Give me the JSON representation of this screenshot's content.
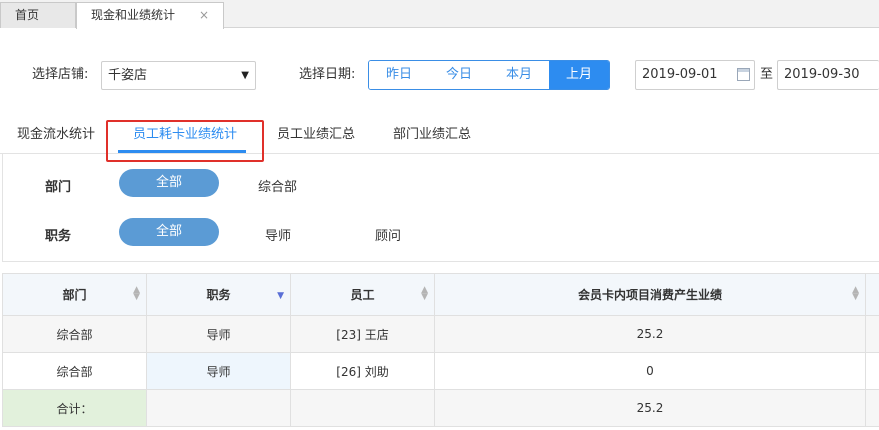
{
  "tabs": {
    "home": "首页",
    "active": "现金和业绩统计",
    "close": "×"
  },
  "filters": {
    "store_label": "选择店铺:",
    "store_value": "千姿店",
    "date_label": "选择日期:",
    "quick_dates": [
      "昨日",
      "今日",
      "本月",
      "上月"
    ],
    "quick_selected": "上月",
    "start_date": "2019-09-01",
    "to_label": "至",
    "end_date": "2019-09-30"
  },
  "subtabs": {
    "items": [
      "现金流水统计",
      "员工耗卡业绩统计",
      "员工业绩汇总",
      "部门业绩汇总"
    ],
    "active": "员工耗卡业绩统计"
  },
  "panel": {
    "dept_label": "部门",
    "dept_all": "全部",
    "dept_options": [
      "综合部"
    ],
    "role_label": "职务",
    "role_all": "全部",
    "role_options": [
      "导师",
      "顾问"
    ]
  },
  "table": {
    "headers": [
      "部门",
      "职务",
      "员工",
      "会员卡内项目消费产生业绩"
    ],
    "rows": [
      [
        "综合部",
        "导师",
        "[23] 王店",
        "25.2"
      ],
      [
        "综合部",
        "导师",
        "[26] 刘助",
        "0"
      ]
    ],
    "total_label": "合计：",
    "total_value": "25.2"
  },
  "colors": {
    "accent": "#2d8cf0",
    "pill": "#5b9bd5",
    "highlight": "#e0302a"
  }
}
